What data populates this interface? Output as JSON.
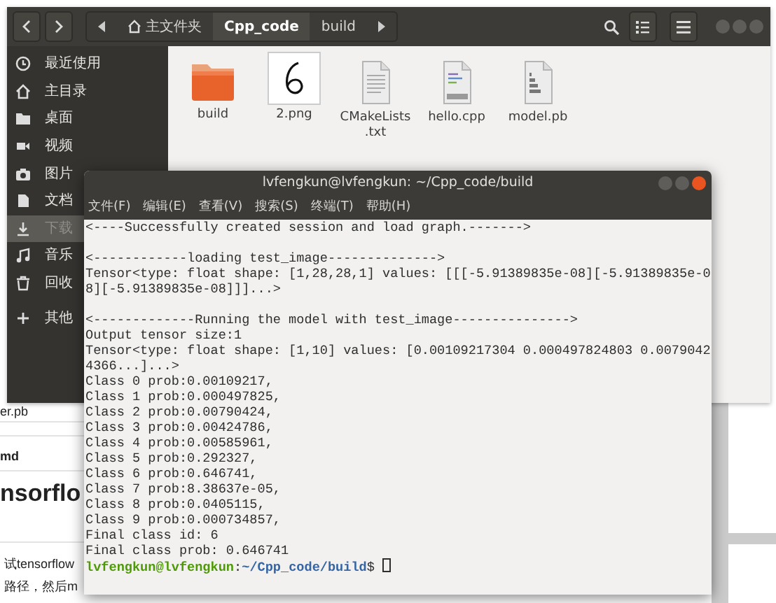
{
  "background_page": {
    "texts": [
      {
        "kind": "file",
        "text": "er.pb"
      },
      {
        "kind": "label",
        "text": "md"
      },
      {
        "kind": "heading",
        "text": "nsorflo"
      },
      {
        "kind": "body",
        "text": "试tensorflow"
      },
      {
        "kind": "body",
        "text": "路径，然后m"
      }
    ]
  },
  "file_manager": {
    "path": [
      {
        "label": "主文件夹",
        "kind": "home",
        "selected": false
      },
      {
        "label": "Cpp_code",
        "kind": "folder",
        "selected": true
      },
      {
        "label": "build",
        "kind": "folder",
        "selected": false
      }
    ],
    "sidebar": {
      "items": [
        {
          "label": "最近使用",
          "selected": false
        },
        {
          "label": "主目录",
          "selected": false
        },
        {
          "label": "桌面",
          "selected": false
        },
        {
          "label": "视频",
          "selected": false
        },
        {
          "label": "图片",
          "selected": false
        },
        {
          "label": "文档",
          "selected": false
        },
        {
          "label": "下载",
          "selected": true
        },
        {
          "label": "音乐",
          "selected": false
        },
        {
          "label": "回收",
          "selected": false
        },
        {
          "label": "其他",
          "selected": false
        }
      ]
    },
    "files": [
      {
        "name": "build",
        "kind": "folder"
      },
      {
        "name": "2.png"
      },
      {
        "name": "CMakeLists.txt",
        "kind": "text"
      },
      {
        "name": "hello.cpp",
        "kind": "cpp"
      },
      {
        "name": "model.pb",
        "kind": "binary"
      }
    ]
  },
  "terminal": {
    "title": "lvfengkun@lvfengkun: ~/Cpp_code/build",
    "menu": [
      "文件(F)",
      "编辑(E)",
      "查看(V)",
      "搜索(S)",
      "终端(T)",
      "帮助(H)"
    ],
    "lines": [
      {
        "kind": "output",
        "text": "<----Successfully created session and load graph.------->"
      },
      {
        "kind": "blank"
      },
      {
        "kind": "output",
        "text": "<------------loading test_image-------------->"
      },
      {
        "kind": "output",
        "text": "Tensor<type: float shape: [1,28,28,1] values: [[[-5.91389835e-08][-5.91389835e-0"
      },
      {
        "kind": "output",
        "text": "8][-5.91389835e-08]]]...>"
      },
      {
        "kind": "blank"
      },
      {
        "kind": "output",
        "text": "<-------------Running the model with test_image--------------->"
      },
      {
        "kind": "output",
        "text": "Output tensor size:1"
      },
      {
        "kind": "output",
        "text": "Tensor<type: float shape: [1,10] values: [0.00109217304 0.000497824803 0.0079042"
      },
      {
        "kind": "output",
        "text": "4366...]...>"
      },
      {
        "kind": "output",
        "text": "Class 0 prob:0.00109217,"
      },
      {
        "kind": "output",
        "text": "Class 1 prob:0.000497825,"
      },
      {
        "kind": "output",
        "text": "Class 2 prob:0.00790424,"
      },
      {
        "kind": "output",
        "text": "Class 3 prob:0.00424786,"
      },
      {
        "kind": "output",
        "text": "Class 4 prob:0.00585961,"
      },
      {
        "kind": "output",
        "text": "Class 5 prob:0.292327,"
      },
      {
        "kind": "output",
        "text": "Class 6 prob:0.646741,"
      },
      {
        "kind": "output",
        "text": "Class 7 prob:8.38637e-05,"
      },
      {
        "kind": "output",
        "text": "Class 8 prob:0.0405115,"
      },
      {
        "kind": "output",
        "text": "Class 9 prob:0.000734857,"
      },
      {
        "kind": "output",
        "text": "Final class id: 6"
      },
      {
        "kind": "output",
        "text": "Final class prob: 0.646741"
      },
      {
        "kind": "prompt",
        "user": "lvfengkun@lvfengkun",
        "separator": ":",
        "path": "~/Cpp_code/build",
        "symbol": "$"
      }
    ]
  }
}
